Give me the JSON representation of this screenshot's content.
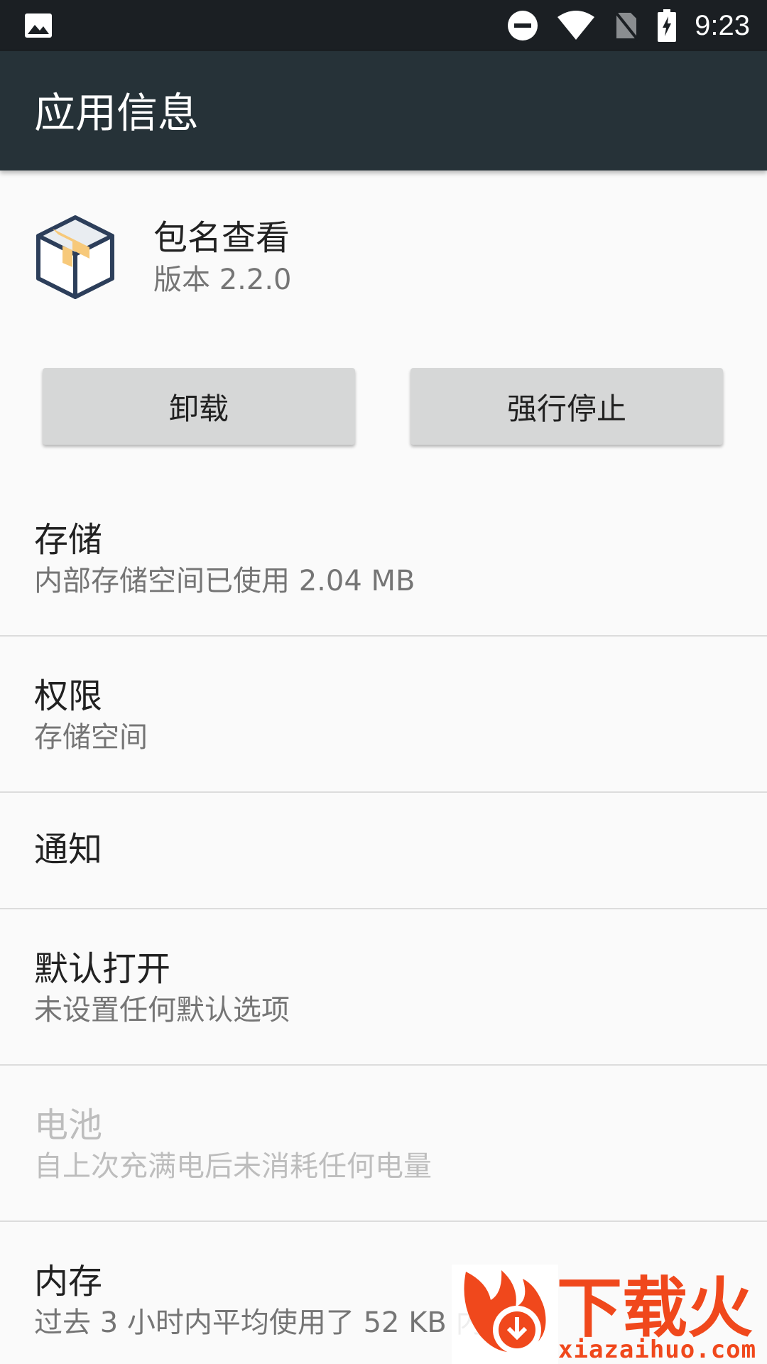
{
  "status_bar": {
    "time": "9:23",
    "icons": [
      "image-icon",
      "do-not-disturb-icon",
      "wifi-icon",
      "no-sim-icon",
      "battery-charging-icon"
    ]
  },
  "app_bar": {
    "title": "应用信息"
  },
  "app": {
    "name": "包名查看",
    "version": "版本 2.2.0",
    "icon": "package-box-icon"
  },
  "buttons": {
    "uninstall": "卸载",
    "force_stop": "强行停止"
  },
  "items": [
    {
      "title": "存储",
      "summary": "内部存储空间已使用 2.04 MB"
    },
    {
      "title": "权限",
      "summary": "存储空间"
    },
    {
      "title": "通知",
      "summary": ""
    },
    {
      "title": "默认打开",
      "summary": "未设置任何默认选项"
    },
    {
      "title": "电池",
      "summary": "自上次充满电后未消耗任何电量",
      "disabled": true
    },
    {
      "title": "内存",
      "summary": "过去 3 小时内平均使用了 52 KB 内存"
    }
  ],
  "watermark": {
    "text": "下载火",
    "url": "xiazaihuo.com"
  },
  "colors": {
    "status_bar": "#1b1f23",
    "app_bar": "#263238",
    "background": "#fafafa",
    "button": "#d6d7d7",
    "watermark": "#f0481c"
  }
}
